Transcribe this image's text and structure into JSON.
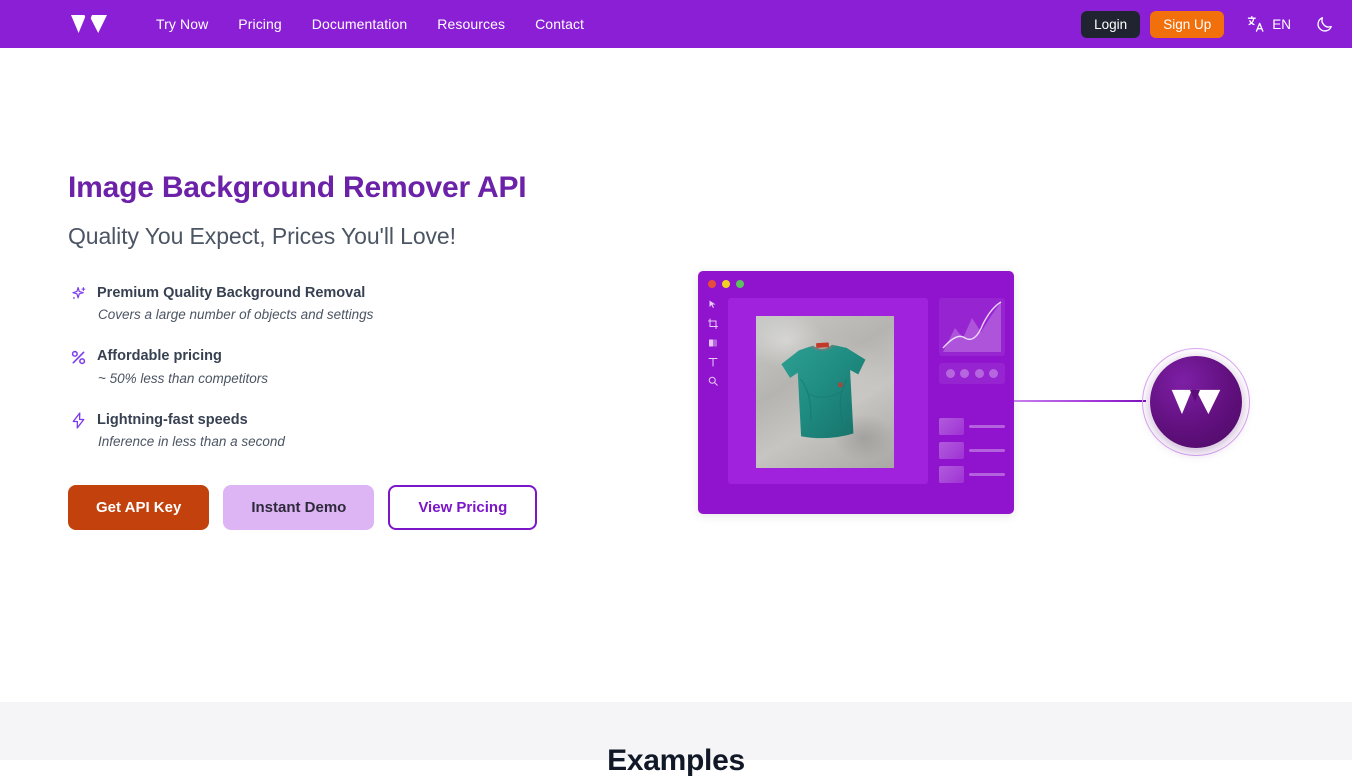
{
  "navbar": {
    "logo_alt": "Witai W logo",
    "links": [
      {
        "label": "Try Now"
      },
      {
        "label": "Pricing"
      },
      {
        "label": "Documentation"
      },
      {
        "label": "Resources"
      },
      {
        "label": "Contact"
      }
    ],
    "login_label": "Login",
    "signup_label": "Sign Up",
    "language_label": "EN",
    "translate_icon": "translate-icon",
    "theme_icon": "moon-icon",
    "bg_color": "#8B1FD6",
    "login_bg": "#1F2430",
    "signup_bg": "#F2700C"
  },
  "hero": {
    "title": "Image Background Remover API",
    "subtitle": "Quality You Expect, Prices You'll Love!",
    "title_color": "#6B21A8",
    "features": [
      {
        "icon": "sparkles-icon",
        "title": "Premium Quality Background Removal",
        "desc": "Covers a large number of objects and settings"
      },
      {
        "icon": "percent-icon",
        "title": "Affordable pricing",
        "desc": "~ 50% less than competitors"
      },
      {
        "icon": "lightning-bolt-icon",
        "title": "Lightning-fast speeds",
        "desc": "Inference in less than a second"
      }
    ],
    "buttons": [
      {
        "label": "Get API Key",
        "style": "primary",
        "color": "#C2410C"
      },
      {
        "label": "Instant Demo",
        "style": "secondary",
        "color": "#DDB5F5"
      },
      {
        "label": "View Pricing",
        "style": "outline",
        "color": "#7C16C9"
      }
    ]
  },
  "illustration": {
    "window_title_dots": [
      "red",
      "yellow",
      "green"
    ],
    "toolbar_icons": [
      "cursor-icon",
      "crop-icon",
      "gradient-square-icon",
      "text-tool-icon",
      "zoom-search-icon"
    ],
    "canvas_subject": "teal t-shirt on concrete background",
    "panel_icons": [
      "settings-icon",
      "droplet-icon",
      "contrast-icon",
      "undo-icon"
    ],
    "layer_count": 3,
    "window_bg": "#9014CE",
    "logo_badge_alt": "Witai circular logo badge"
  },
  "examples": {
    "title": "Examples",
    "bg_color": "#F5F5F7"
  }
}
